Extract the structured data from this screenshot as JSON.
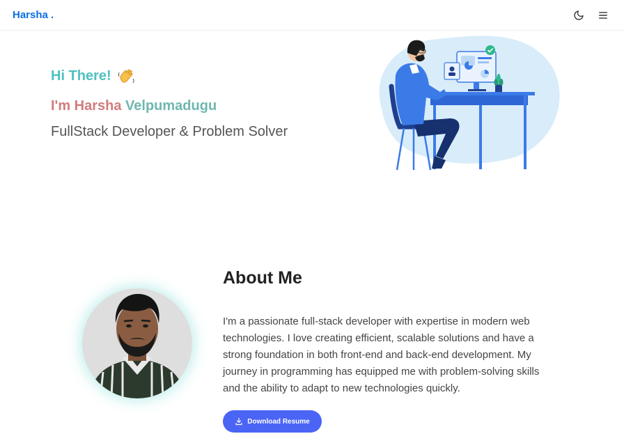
{
  "navbar": {
    "logo": "Harsha .",
    "theme_icon": "moon-icon",
    "menu_icon": "hamburger-menu-icon"
  },
  "hero": {
    "greeting": "Hi There!",
    "greeting_icon": "waving-hand-icon",
    "name_prefix": "I'm Harsha",
    "name_last": "Velpumadugu",
    "role": "FullStack Developer & Problem Solver",
    "illustration": "developer-at-desk-illustration"
  },
  "about": {
    "title": "About Me",
    "photo": "profile-photo",
    "paragraph": "I'm a passionate full-stack developer with expertise in modern web technologies. I love creating efficient, scalable solutions and have a strong foundation in both front-end and back-end development. My journey in programming has equipped me with problem-solving skills and the ability to adapt to new technologies quickly.",
    "resume_button": "Download Resume",
    "resume_icon": "download-icon"
  },
  "colors": {
    "accent": "#4a64f5",
    "logo": "#0b6ee0",
    "greeting": "#4fc1c0",
    "name_first": "#d27c7c",
    "name_last": "#6fb7b0"
  }
}
